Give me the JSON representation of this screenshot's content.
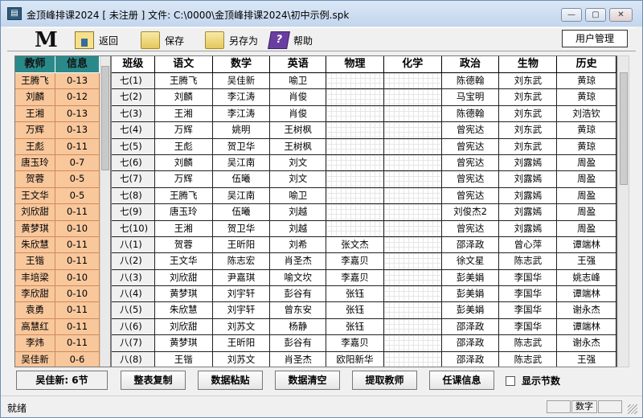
{
  "window": {
    "title": "金顶峰排课2024 [ 未注册 ] 文件: C:\\0000\\金顶峰排课2024\\初中示例.spk",
    "min": "—",
    "max": "▢",
    "close": "✕"
  },
  "toolbar": {
    "logo": "M",
    "back": "返回",
    "save": "保存",
    "saveas": "另存为",
    "help": "帮助",
    "help_glyph": "?",
    "user_mgmt": "用户管理"
  },
  "teachers": {
    "header": [
      "教师",
      "信息"
    ],
    "rows": [
      [
        "王腾飞",
        "0-13"
      ],
      [
        "刘麟",
        "0-12"
      ],
      [
        "王湘",
        "0-13"
      ],
      [
        "万辉",
        "0-13"
      ],
      [
        "王彪",
        "0-11"
      ],
      [
        "唐玉玲",
        "0-7"
      ],
      [
        "贺蓉",
        "0-5"
      ],
      [
        "王文华",
        "0-5"
      ],
      [
        "刘欣甜",
        "0-11"
      ],
      [
        "黄梦琪",
        "0-10"
      ],
      [
        "朱欣慧",
        "0-11"
      ],
      [
        "王锴",
        "0-11"
      ],
      [
        "丰培梁",
        "0-10"
      ],
      [
        "李欣甜",
        "0-10"
      ],
      [
        "袁勇",
        "0-11"
      ],
      [
        "高慧红",
        "0-11"
      ],
      [
        "李炜",
        "0-11"
      ],
      [
        "吴佳新",
        "0-6"
      ]
    ]
  },
  "grid": {
    "header": [
      "班级",
      "语文",
      "数学",
      "英语",
      "物理",
      "化学",
      "政治",
      "生物",
      "历史"
    ],
    "rows": [
      [
        "七(1)",
        "王腾飞",
        "吴佳新",
        "喻卫",
        "",
        "",
        "陈德翰",
        "刘东武",
        "黄琼"
      ],
      [
        "七(2)",
        "刘麟",
        "李江涛",
        "肖俊",
        "",
        "",
        "马宝明",
        "刘东武",
        "黄琼"
      ],
      [
        "七(3)",
        "王湘",
        "李江涛",
        "肖俊",
        "",
        "",
        "陈德翰",
        "刘东武",
        "刘浩钦"
      ],
      [
        "七(4)",
        "万辉",
        "姚明",
        "王树枫",
        "",
        "",
        "曾宪达",
        "刘东武",
        "黄琼"
      ],
      [
        "七(5)",
        "王彪",
        "贺卫华",
        "王树枫",
        "",
        "",
        "曾宪达",
        "刘东武",
        "黄琼"
      ],
      [
        "七(6)",
        "刘麟",
        "吴江南",
        "刘文",
        "",
        "",
        "曾宪达",
        "刘露嫣",
        "周盈"
      ],
      [
        "七(7)",
        "万辉",
        "伍曦",
        "刘文",
        "",
        "",
        "曾宪达",
        "刘露嫣",
        "周盈"
      ],
      [
        "七(8)",
        "王腾飞",
        "吴江南",
        "喻卫",
        "",
        "",
        "曾宪达",
        "刘露嫣",
        "周盈"
      ],
      [
        "七(9)",
        "唐玉玲",
        "伍曦",
        "刘越",
        "",
        "",
        "刘俊杰2",
        "刘露嫣",
        "周盈"
      ],
      [
        "七(10)",
        "王湘",
        "贺卫华",
        "刘越",
        "",
        "",
        "曾宪达",
        "刘露嫣",
        "周盈"
      ],
      [
        "八(1)",
        "贺蓉",
        "王昕阳",
        "刘希",
        "张文杰",
        "",
        "邵泽政",
        "曾心萍",
        "谭端林"
      ],
      [
        "八(2)",
        "王文华",
        "陈志宏",
        "肖圣杰",
        "李嘉贝",
        "",
        "徐文星",
        "陈志武",
        "王强"
      ],
      [
        "八(3)",
        "刘欣甜",
        "尹嘉琪",
        "喻文坎",
        "李嘉贝",
        "",
        "彭美娟",
        "李国华",
        "姚志峰"
      ],
      [
        "八(4)",
        "黄梦琪",
        "刘宇轩",
        "彭谷有",
        "张钰",
        "",
        "彭美娟",
        "李国华",
        "谭端林"
      ],
      [
        "八(5)",
        "朱欣慧",
        "刘宇轩",
        "曾东安",
        "张钰",
        "",
        "彭美娟",
        "李国华",
        "谢永杰"
      ],
      [
        "八(6)",
        "刘欣甜",
        "刘苏文",
        "杨静",
        "张钰",
        "",
        "邵泽政",
        "李国华",
        "谭端林"
      ],
      [
        "八(7)",
        "黄梦琪",
        "王昕阳",
        "彭谷有",
        "李嘉贝",
        "",
        "邵泽政",
        "陈志武",
        "谢永杰"
      ],
      [
        "八(8)",
        "王锴",
        "刘苏文",
        "肖圣杰",
        "欧阳新华",
        "",
        "邵泽政",
        "陈志武",
        "王强"
      ]
    ]
  },
  "bottom": {
    "status_btn": "吴佳新: 6节",
    "b1": "整表复制",
    "b2": "数据粘贴",
    "b3": "数据清空",
    "b4": "提取教师",
    "b5": "任课信息",
    "checkbox_label": "显示节数"
  },
  "statusbar": {
    "text": "就绪",
    "num": "数字"
  }
}
